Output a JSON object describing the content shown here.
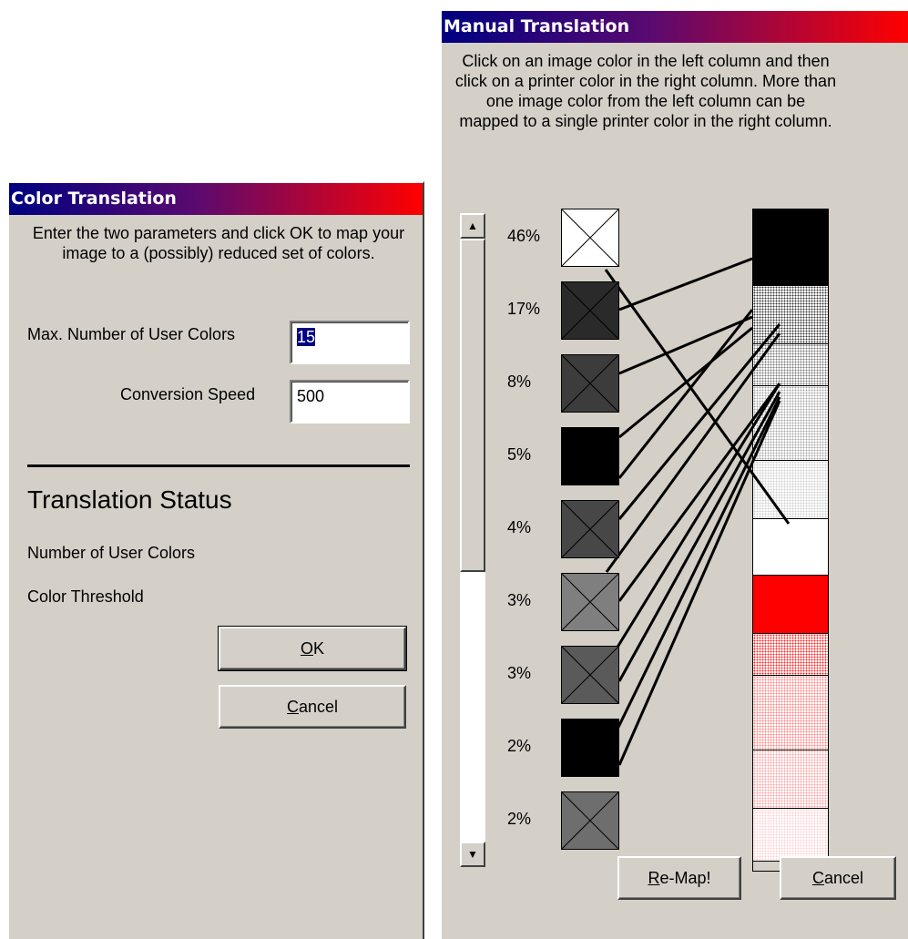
{
  "color_dialog": {
    "title": "Color Translation",
    "description": "Enter the two parameters and click OK to map your image to a (possibly) reduced set of colors.",
    "max_colors_label": "Max. Number of User Colors",
    "max_colors_value": "15",
    "speed_label": "Conversion Speed",
    "speed_value": "500",
    "status_heading": "Translation Status",
    "num_colors_label": "Number of User Colors",
    "threshold_label": "Color Threshold",
    "ok_label": "OK",
    "ok_mnemonic": "O",
    "ok_rest": "K",
    "cancel_mnemonic": "C",
    "cancel_rest": "ancel"
  },
  "manual_dialog": {
    "title": "Manual Translation",
    "description": "Click on an image color in the left column and then click on a printer color in the right column.  More than one image color from the left column can be mapped to a single printer color in the right column.",
    "image_colors": [
      {
        "pct": "46%",
        "fill": "#ffffff",
        "cross": "#000000"
      },
      {
        "pct": "17%",
        "fill": "#2a2a2a",
        "cross": "#000000"
      },
      {
        "pct": "8%",
        "fill": "#3c3c3c",
        "cross": "#000000"
      },
      {
        "pct": "5%",
        "fill": "#000000",
        "cross": "none"
      },
      {
        "pct": "4%",
        "fill": "#474747",
        "cross": "#000000"
      },
      {
        "pct": "3%",
        "fill": "#7f7f7f",
        "cross": "#000000"
      },
      {
        "pct": "3%",
        "fill": "#5a5a5a",
        "cross": "#000000"
      },
      {
        "pct": "2%",
        "fill": "#000000",
        "cross": "none"
      },
      {
        "pct": "2%",
        "fill": "#6e6e6e",
        "cross": "#000000"
      }
    ],
    "printer_colors": [
      {
        "name": "black",
        "color": "#000000"
      },
      {
        "name": "dark-gray-pattern",
        "color": "#3a3a3a"
      },
      {
        "name": "gray-pattern",
        "color": "#7a7a7a"
      },
      {
        "name": "light-gray-pattern",
        "color": "#a8a8a8"
      },
      {
        "name": "lighter-gray-pattern",
        "color": "#cfcfcf"
      },
      {
        "name": "white",
        "color": "#ffffff"
      },
      {
        "name": "red",
        "color": "#ff0000"
      },
      {
        "name": "red-pattern",
        "color": "#ff2020"
      },
      {
        "name": "light-red-pattern",
        "color": "#ff8080"
      },
      {
        "name": "pale-red-pattern",
        "color": "#ffa0a0"
      },
      {
        "name": "palest-red-pattern",
        "color": "#ffd0d0"
      }
    ],
    "remap_mnemonic": "R",
    "remap_rest": "e-Map!",
    "cancel_mnemonic": "C",
    "cancel_rest": "ancel",
    "scroll_up_icon": "up-arrow-icon",
    "scroll_down_icon": "down-arrow-icon"
  }
}
